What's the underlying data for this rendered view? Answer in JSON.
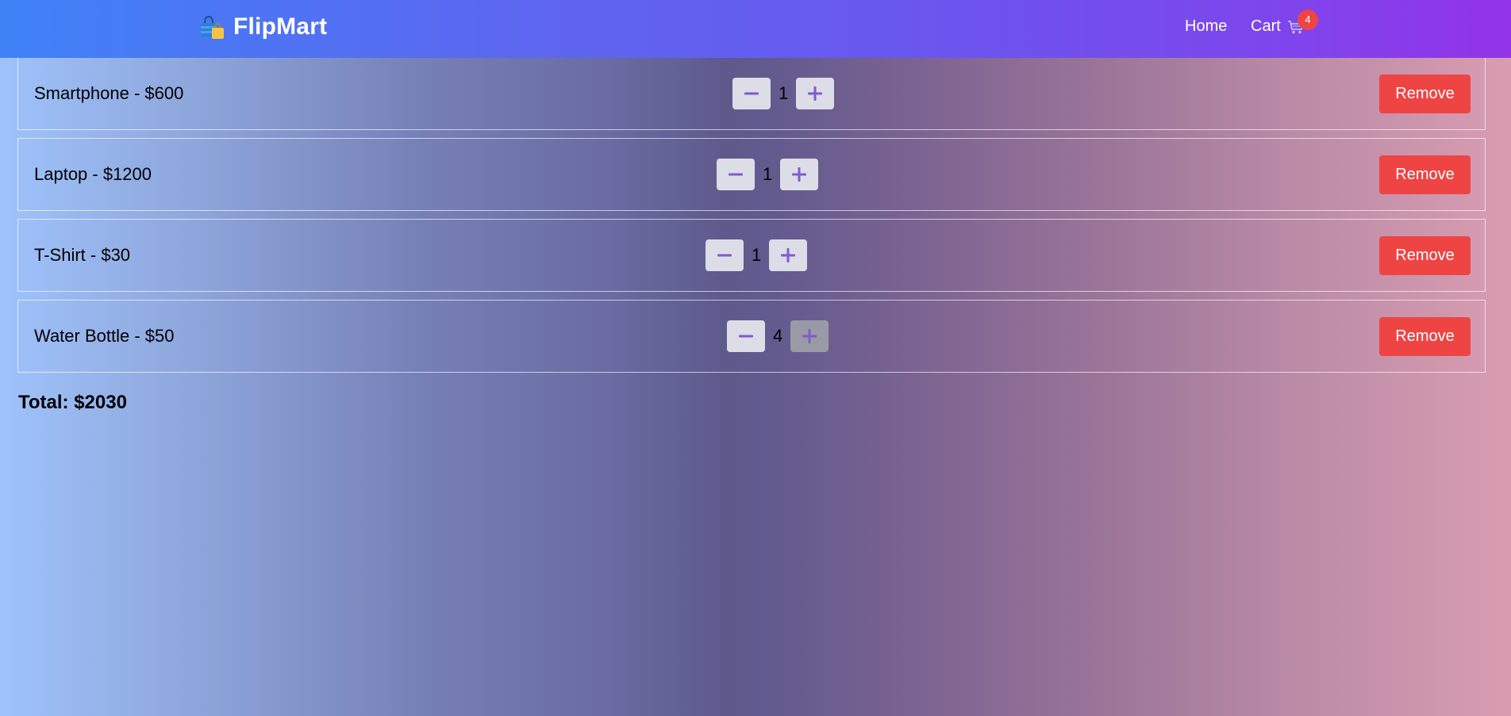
{
  "navbar": {
    "brand": "FlipMart",
    "brand_icon": "shopping-bags-icon",
    "home_label": "Home",
    "cart_label": "Cart",
    "cart_icon": "cart-icon",
    "cart_count": "4",
    "colors": {
      "gradient_start": "#3f82f6",
      "gradient_end": "#9333ea",
      "badge": "#ef4444"
    }
  },
  "cart": {
    "items": [
      {
        "label": "Smartphone - $600",
        "quantity": "1"
      },
      {
        "label": "Laptop - $1200",
        "quantity": "1"
      },
      {
        "label": "T-Shirt - $30",
        "quantity": "1"
      },
      {
        "label": "Water Bottle - $50",
        "quantity": "4"
      }
    ],
    "remove_label": "Remove",
    "decrement_icon": "minus-icon",
    "increment_icon": "plus-icon",
    "colors": {
      "remove_button": "#ef4444",
      "qty_icon": "#7c5ccf"
    }
  },
  "total_label": "Total: $2030"
}
